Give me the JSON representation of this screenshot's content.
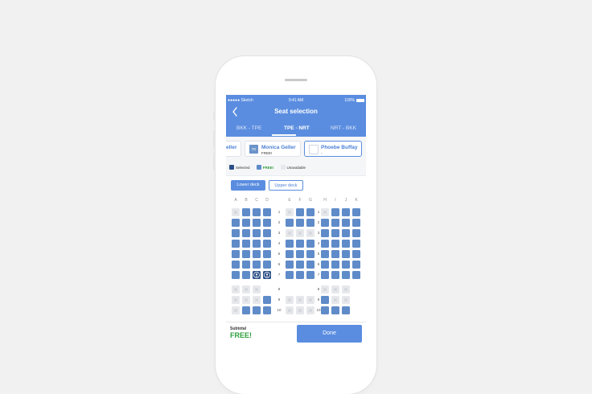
{
  "status_bar": {
    "carrier": "●●●●● Sketch",
    "time": "9:41 AM",
    "battery": "100%"
  },
  "header": {
    "title": "Seat selection",
    "back_icon": "chevron-left-icon"
  },
  "tabs": [
    {
      "label": "BKK - TPE",
      "active": false
    },
    {
      "label": "TPE - NRT",
      "active": true
    },
    {
      "label": "NRT - BKK",
      "active": false
    }
  ],
  "passengers": [
    {
      "name": "eller",
      "seat": "",
      "price": ""
    },
    {
      "name": "Monica Geller",
      "seat": "7D",
      "price": "FREE!"
    },
    {
      "name": "Phoebe Buffay",
      "seat": "",
      "price": "-"
    }
  ],
  "legend": [
    {
      "label": "Selected",
      "color": "#2c4f87"
    },
    {
      "label": "FREE!",
      "color": "#5f8bc9"
    },
    {
      "label": "Unavailable",
      "color": "#e6e8ec"
    }
  ],
  "decks": [
    {
      "label": "Lower deck",
      "active": true
    },
    {
      "label": "Upper deck",
      "active": false
    }
  ],
  "columns": [
    "A",
    "B",
    "C",
    "D",
    "E",
    "F",
    "G",
    "H",
    "I",
    "J",
    "K"
  ],
  "rows": [
    {
      "num": "1",
      "seats": "UFFF UFF UFFF"
    },
    {
      "num": "2",
      "seats": "FFFF FFF FFFF"
    },
    {
      "num": "3",
      "seats": "FFFF UUU FFFF"
    },
    {
      "num": "4",
      "seats": "FFFF FFF FFFF"
    },
    {
      "num": "5",
      "seats": "FFFF FFF FFFF"
    },
    {
      "num": "6",
      "seats": "FFFF FFF FFFF"
    },
    {
      "num": "7",
      "seats": "FFSS FFF FFFF"
    },
    {
      "num": "8",
      "seats": "UUU- --- UUU-"
    },
    {
      "num": "9",
      "seats": "UUUF UUU FUU-"
    },
    {
      "num": "10",
      "seats": "UFFF UUU FFF-"
    }
  ],
  "fab_icon": "expand-arrows-icon",
  "footer": {
    "subtotal_label": "Subtotal",
    "subtotal_value": "FREE!",
    "done_label": "Done"
  },
  "colors": {
    "accent": "#5a8de0",
    "free": "#5f8bc9",
    "selected": "#2c4f87",
    "unavailable": "#e6e8ec",
    "price_green": "#2e9e3e"
  }
}
